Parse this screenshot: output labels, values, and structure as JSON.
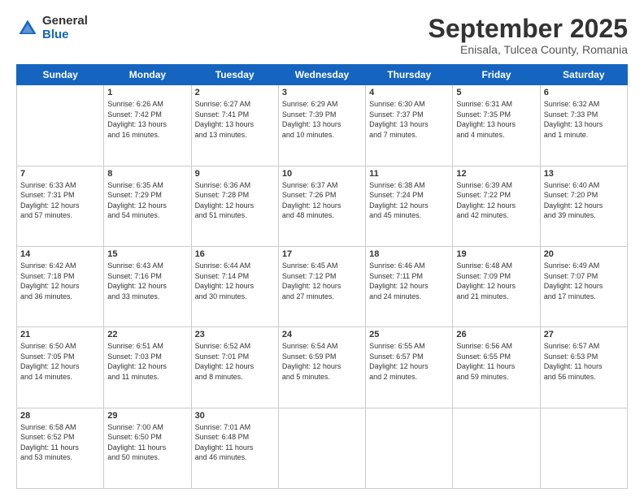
{
  "logo": {
    "general": "General",
    "blue": "Blue"
  },
  "title": "September 2025",
  "subtitle": "Enisala, Tulcea County, Romania",
  "days_of_week": [
    "Sunday",
    "Monday",
    "Tuesday",
    "Wednesday",
    "Thursday",
    "Friday",
    "Saturday"
  ],
  "weeks": [
    [
      {
        "num": "",
        "info": ""
      },
      {
        "num": "1",
        "info": "Sunrise: 6:26 AM\nSunset: 7:42 PM\nDaylight: 13 hours\nand 16 minutes."
      },
      {
        "num": "2",
        "info": "Sunrise: 6:27 AM\nSunset: 7:41 PM\nDaylight: 13 hours\nand 13 minutes."
      },
      {
        "num": "3",
        "info": "Sunrise: 6:29 AM\nSunset: 7:39 PM\nDaylight: 13 hours\nand 10 minutes."
      },
      {
        "num": "4",
        "info": "Sunrise: 6:30 AM\nSunset: 7:37 PM\nDaylight: 13 hours\nand 7 minutes."
      },
      {
        "num": "5",
        "info": "Sunrise: 6:31 AM\nSunset: 7:35 PM\nDaylight: 13 hours\nand 4 minutes."
      },
      {
        "num": "6",
        "info": "Sunrise: 6:32 AM\nSunset: 7:33 PM\nDaylight: 13 hours\nand 1 minute."
      }
    ],
    [
      {
        "num": "7",
        "info": "Sunrise: 6:33 AM\nSunset: 7:31 PM\nDaylight: 12 hours\nand 57 minutes."
      },
      {
        "num": "8",
        "info": "Sunrise: 6:35 AM\nSunset: 7:29 PM\nDaylight: 12 hours\nand 54 minutes."
      },
      {
        "num": "9",
        "info": "Sunrise: 6:36 AM\nSunset: 7:28 PM\nDaylight: 12 hours\nand 51 minutes."
      },
      {
        "num": "10",
        "info": "Sunrise: 6:37 AM\nSunset: 7:26 PM\nDaylight: 12 hours\nand 48 minutes."
      },
      {
        "num": "11",
        "info": "Sunrise: 6:38 AM\nSunset: 7:24 PM\nDaylight: 12 hours\nand 45 minutes."
      },
      {
        "num": "12",
        "info": "Sunrise: 6:39 AM\nSunset: 7:22 PM\nDaylight: 12 hours\nand 42 minutes."
      },
      {
        "num": "13",
        "info": "Sunrise: 6:40 AM\nSunset: 7:20 PM\nDaylight: 12 hours\nand 39 minutes."
      }
    ],
    [
      {
        "num": "14",
        "info": "Sunrise: 6:42 AM\nSunset: 7:18 PM\nDaylight: 12 hours\nand 36 minutes."
      },
      {
        "num": "15",
        "info": "Sunrise: 6:43 AM\nSunset: 7:16 PM\nDaylight: 12 hours\nand 33 minutes."
      },
      {
        "num": "16",
        "info": "Sunrise: 6:44 AM\nSunset: 7:14 PM\nDaylight: 12 hours\nand 30 minutes."
      },
      {
        "num": "17",
        "info": "Sunrise: 6:45 AM\nSunset: 7:12 PM\nDaylight: 12 hours\nand 27 minutes."
      },
      {
        "num": "18",
        "info": "Sunrise: 6:46 AM\nSunset: 7:11 PM\nDaylight: 12 hours\nand 24 minutes."
      },
      {
        "num": "19",
        "info": "Sunrise: 6:48 AM\nSunset: 7:09 PM\nDaylight: 12 hours\nand 21 minutes."
      },
      {
        "num": "20",
        "info": "Sunrise: 6:49 AM\nSunset: 7:07 PM\nDaylight: 12 hours\nand 17 minutes."
      }
    ],
    [
      {
        "num": "21",
        "info": "Sunrise: 6:50 AM\nSunset: 7:05 PM\nDaylight: 12 hours\nand 14 minutes."
      },
      {
        "num": "22",
        "info": "Sunrise: 6:51 AM\nSunset: 7:03 PM\nDaylight: 12 hours\nand 11 minutes."
      },
      {
        "num": "23",
        "info": "Sunrise: 6:52 AM\nSunset: 7:01 PM\nDaylight: 12 hours\nand 8 minutes."
      },
      {
        "num": "24",
        "info": "Sunrise: 6:54 AM\nSunset: 6:59 PM\nDaylight: 12 hours\nand 5 minutes."
      },
      {
        "num": "25",
        "info": "Sunrise: 6:55 AM\nSunset: 6:57 PM\nDaylight: 12 hours\nand 2 minutes."
      },
      {
        "num": "26",
        "info": "Sunrise: 6:56 AM\nSunset: 6:55 PM\nDaylight: 11 hours\nand 59 minutes."
      },
      {
        "num": "27",
        "info": "Sunrise: 6:57 AM\nSunset: 6:53 PM\nDaylight: 11 hours\nand 56 minutes."
      }
    ],
    [
      {
        "num": "28",
        "info": "Sunrise: 6:58 AM\nSunset: 6:52 PM\nDaylight: 11 hours\nand 53 minutes."
      },
      {
        "num": "29",
        "info": "Sunrise: 7:00 AM\nSunset: 6:50 PM\nDaylight: 11 hours\nand 50 minutes."
      },
      {
        "num": "30",
        "info": "Sunrise: 7:01 AM\nSunset: 6:48 PM\nDaylight: 11 hours\nand 46 minutes."
      },
      {
        "num": "",
        "info": ""
      },
      {
        "num": "",
        "info": ""
      },
      {
        "num": "",
        "info": ""
      },
      {
        "num": "",
        "info": ""
      }
    ]
  ]
}
